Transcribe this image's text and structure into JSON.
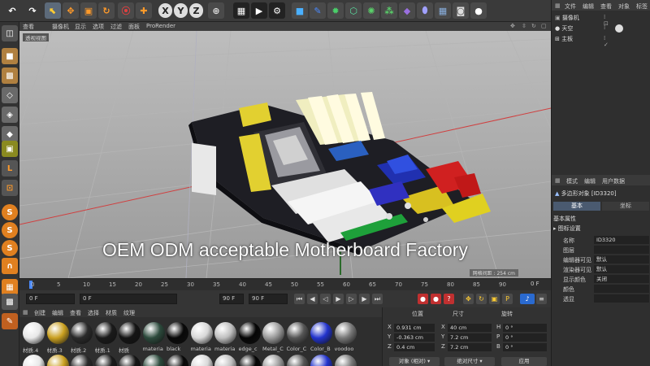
{
  "toolbar": {
    "axis_x": "X",
    "axis_y": "Y",
    "axis_z": "Z"
  },
  "viewport": {
    "menu": [
      "查看",
      "摄像机",
      "显示",
      "选项",
      "过滤",
      "面板",
      "ProRender"
    ],
    "title": "透视视图",
    "grid_spacing": "网格间距 : 254 cm",
    "overlay_text": "OEM ODM acceptable Motherboard Factory"
  },
  "timeline": {
    "ticks": [
      "0",
      "5",
      "10",
      "15",
      "20",
      "25",
      "30",
      "35",
      "40",
      "45",
      "50",
      "55",
      "60",
      "65",
      "70",
      "75",
      "80",
      "85",
      "90"
    ],
    "current_frame": "0 F",
    "start_frame": "0 F",
    "current_field": "0 F",
    "end_frame_1": "90 F",
    "end_frame_2": "90 F"
  },
  "materials": {
    "menu": [
      "创建",
      "编辑",
      "查看",
      "选择",
      "材质",
      "纹理"
    ],
    "row1": [
      {
        "label": "材质.4",
        "color": "#e8e8e8"
      },
      {
        "label": "材质.3",
        "color": "#caa020"
      },
      {
        "label": "材质.2",
        "color": "#2a2a2a"
      },
      {
        "label": "材质.1",
        "color": "#1a1a1a"
      },
      {
        "label": "材质",
        "color": "#141414"
      },
      {
        "label": "materia",
        "color": "#2c4a3c"
      },
      {
        "label": "black",
        "color": "#080808"
      },
      {
        "label": "materia",
        "color": "#d8d8d8"
      },
      {
        "label": "materia",
        "color": "#bfbfbf"
      },
      {
        "label": "edge_c",
        "color": "#050505"
      },
      {
        "label": "Metal_C",
        "color": "#9a9a9a"
      },
      {
        "label": "Color_C",
        "color": "#555555"
      },
      {
        "label": "Color_B",
        "color": "#2233cc"
      },
      {
        "label": "voodoo",
        "color": "#777777"
      }
    ]
  },
  "coordinates": {
    "headers": {
      "position": "位置",
      "size": "尺寸",
      "rotation": "旋转"
    },
    "rows": [
      {
        "axis": "X",
        "pos": "0.931 cm",
        "size_axis": "X",
        "size": "40 cm",
        "rot_axis": "H",
        "rot": "0 °"
      },
      {
        "axis": "Y",
        "pos": "-0.363 cm",
        "size_axis": "Y",
        "size": "7.2 cm",
        "rot_axis": "P",
        "rot": "0 °"
      },
      {
        "axis": "Z",
        "pos": "0.4 cm",
        "size_axis": "Z",
        "size": "7.2 cm",
        "rot_axis": "B",
        "rot": "0 °"
      }
    ],
    "mode": "对象 (相对)",
    "size_mode": "绝对尺寸",
    "apply": "应用"
  },
  "objects": {
    "menu": [
      "文件",
      "编辑",
      "查看",
      "对象",
      "标签"
    ],
    "items": [
      "摄像机",
      "天空",
      "主板"
    ]
  },
  "attributes": {
    "menu": [
      "模式",
      "编辑",
      "用户数据"
    ],
    "object_title": "多边形对象 [ID3320]",
    "tabs": [
      "基本",
      "坐标"
    ],
    "section": "基本属性",
    "subsection": "图标设置",
    "props": [
      {
        "label": "名称",
        "value": "ID3320"
      },
      {
        "label": "图层",
        "value": ""
      },
      {
        "label": "编辑器可见",
        "value": "默认"
      },
      {
        "label": "渲染器可见",
        "value": "默认"
      },
      {
        "label": "显示颜色",
        "value": "关闭"
      },
      {
        "label": "颜色",
        "value": ""
      },
      {
        "label": "透显",
        "value": ""
      }
    ]
  }
}
